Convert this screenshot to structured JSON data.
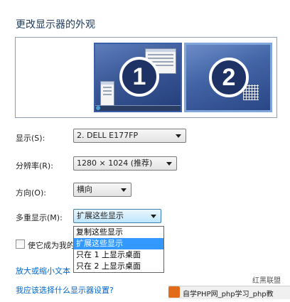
{
  "page_title": "更改显示器的外观",
  "preview": {
    "monitor_1_number": "1",
    "monitor_2_number": "2"
  },
  "fields": {
    "display_label": "显示(S):",
    "display_value": "2. DELL E177FP",
    "resolution_label": "分辨率(R):",
    "resolution_value": "1280 × 1024 (推荐)",
    "orientation_label": "方向(O):",
    "orientation_value": "横向",
    "multiple_label": "多重显示(M):",
    "multiple_value": "扩展这些显示"
  },
  "dropdown": {
    "options": [
      "复制这些显示",
      "扩展这些显示",
      "只在 1 上显示桌面",
      "只在 2 上显示桌面"
    ],
    "selected_index": 1
  },
  "checkbox_label_visible": "使它成为我的",
  "links": {
    "resize_text": "放大或缩小文本",
    "which_settings": "我应该选择什么显示器设置?"
  },
  "watermark": {
    "text": "自学PHP网_php学习_php教",
    "logo_text": "红黑联盟"
  },
  "colors": {
    "title": "#1e395b",
    "link": "#0066cc",
    "selection": "#3399ff",
    "monitor_dark": "#233e7a"
  }
}
